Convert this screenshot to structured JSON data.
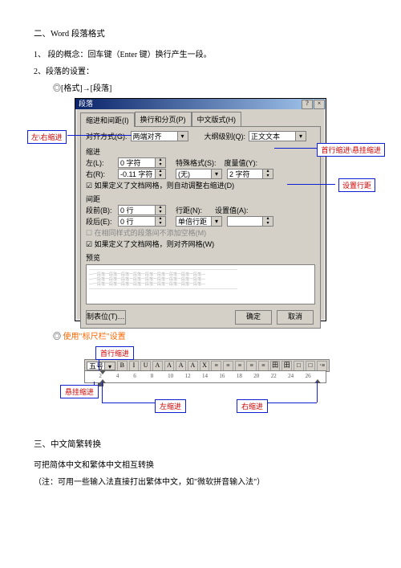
{
  "heading2": "二、Word 段落格式",
  "p1": "1、 段的概念：回车键（Enter 键）换行产生一段。",
  "p2": "2、段落的设置：",
  "bullet1": "◎[格式]→[段落]",
  "bullet2_prefix": "◎ ",
  "bullet2_main": "使用\"标尺栏\"设置",
  "heading3": "三、中文简繁转换",
  "p3": "可把简体中文和繁体中文相互转换",
  "p4": "（注：可用一些输入法直接打出繁体中文，如\"微软拼音输入法\"）",
  "dialog": {
    "title": "段落",
    "close": "×",
    "help": "?",
    "tabs": {
      "t1": "缩进和间距(I)",
      "t2": "换行和分页(P)",
      "t3": "中文版式(H)"
    },
    "align_lbl": "对齐方式(G):",
    "align_val": "两端对齐",
    "outline_lbl": "大纲级别(Q):",
    "outline_val": "正文文本",
    "indent_group": "缩进",
    "left_lbl": "左(L):",
    "left_val": "0 字符",
    "right_lbl": "右(R):",
    "right_val": "-0.11 字符",
    "special_lbl": "特殊格式(S):",
    "special_val": "(无)",
    "measure_lbl": "度量值(Y):",
    "measure_val": "2 字符",
    "grid_chk1": "如果定义了文档网格，则自动调整右缩进(D)",
    "spacing_group": "间距",
    "before_lbl": "段前(B):",
    "before_val": "0 行",
    "after_lbl": "段后(E):",
    "after_val": "0 行",
    "linesp_lbl": "行距(N):",
    "linesp_val": "单倍行距",
    "setat_lbl": "设置值(A):",
    "setat_val": "",
    "chk_same": "在相同样式的段落间不添加空格(M)",
    "chk_grid2": "如果定义了文档网格，则对齐网格(W)",
    "preview_lbl": "预览",
    "btn_tabs": "制表位(T)…",
    "btn_ok": "确定",
    "btn_cancel": "取消"
  },
  "callouts1": {
    "left_right": "左\\右缩进",
    "first_hang": "首行缩进\\悬挂缩进",
    "line_sp": "设置行距"
  },
  "ruler": {
    "size_combo": "五号",
    "btns": [
      "B",
      "I",
      "U",
      "A",
      "A",
      "A",
      "A",
      "X",
      "≡",
      "≡",
      "≡",
      "≡",
      "≡",
      "田",
      "田",
      "□",
      "□",
      "·≡"
    ],
    "ticks": [
      "2",
      "4",
      "6",
      "8",
      "10",
      "12",
      "14",
      "16",
      "18",
      "20",
      "22",
      "24",
      "26"
    ]
  },
  "callouts2": {
    "first": "首行缩进",
    "hang": "悬挂缩进",
    "left": "左缩进",
    "right": "右缩进"
  }
}
